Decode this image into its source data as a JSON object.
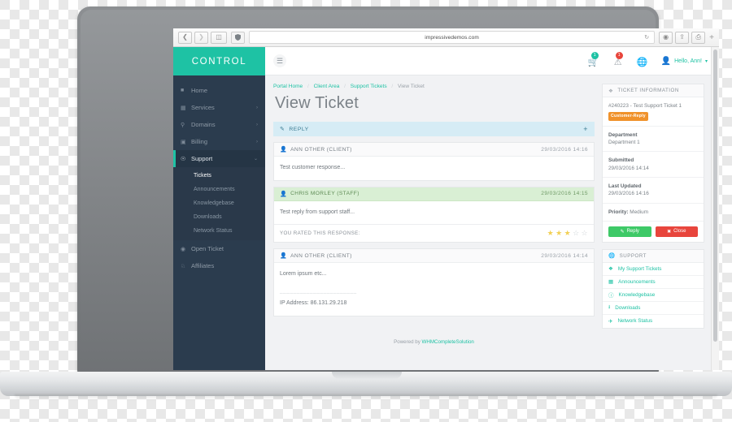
{
  "browser": {
    "url": "impressivedemos.com",
    "back_icon": "chevron-left-icon",
    "forward_icon": "chevron-right-icon",
    "sidebar_icon": "sidebar-toggle-icon",
    "shield_icon": "shield-icon",
    "reload_icon": "reload-icon",
    "download_icon": "download-icon",
    "share_icon": "share-icon",
    "tabs_icon": "tabs-icon",
    "newtab_label": "+"
  },
  "brand": {
    "name": "CONTROL"
  },
  "sidebar": {
    "items": [
      {
        "label": "Home",
        "icon": "home-icon",
        "caret": ""
      },
      {
        "label": "Services",
        "icon": "services-icon",
        "caret": "›"
      },
      {
        "label": "Domains",
        "icon": "domains-icon",
        "caret": "›"
      },
      {
        "label": "Billing",
        "icon": "billing-icon",
        "caret": "›"
      },
      {
        "label": "Support",
        "icon": "support-icon",
        "caret": "⌄"
      }
    ],
    "sub_items": [
      {
        "label": "Tickets"
      },
      {
        "label": "Announcements"
      },
      {
        "label": "Knowledgebase"
      },
      {
        "label": "Downloads"
      },
      {
        "label": "Network Status"
      }
    ],
    "items_after": [
      {
        "label": "Open Ticket",
        "icon": "chat-icon"
      },
      {
        "label": "Affiliates",
        "icon": "affiliates-icon"
      }
    ]
  },
  "topbar": {
    "menu_icon": "hamburger-icon",
    "cart_icon": "cart-icon",
    "cart_badge": "1",
    "alert_icon": "warning-triangle-icon",
    "alert_badge": "1",
    "globe_icon": "globe-icon",
    "user_icon": "user-icon",
    "user_label": "Hello, Ann!",
    "user_caret": "▾"
  },
  "breadcrumb": {
    "items": [
      "Portal Home",
      "Client Area",
      "Support Tickets"
    ],
    "current": "View Ticket",
    "separator": "/"
  },
  "page": {
    "title": "View Ticket"
  },
  "reply_bar": {
    "icon": "pencil-icon",
    "label": "REPLY",
    "expand": "+"
  },
  "messages": [
    {
      "author": "ANN OTHER (CLIENT)",
      "timestamp": "29/03/2016 14:16",
      "body": "Test customer response...",
      "role": "client",
      "icon": "user-icon"
    },
    {
      "author": "CHRIS MORLEY (STAFF)",
      "timestamp": "29/03/2016 14:15",
      "body": "Test reply from support staff...",
      "role": "staff",
      "icon": "user-icon",
      "rating": {
        "label": "YOU RATED THIS RESPONSE:",
        "filled": 3,
        "total": 5
      }
    },
    {
      "author": "ANN OTHER (CLIENT)",
      "timestamp": "29/03/2016 14:14",
      "body": "Lorem ipsum etc...",
      "divider": "_______________________",
      "extra": "IP Address: 86.131.29.218",
      "role": "client",
      "icon": "user-icon"
    }
  ],
  "footer": {
    "prefix": "Powered by ",
    "brand": "WHMCompleteSolution"
  },
  "ticket_info": {
    "heading": "TICKET INFORMATION",
    "heading_icon": "ticket-icon",
    "subject": "#240223 - Test Support Ticket 1",
    "status_badge": "Customer-Reply",
    "status_color": "#f0922b",
    "department_label": "Department",
    "department_value": "Department 1",
    "submitted_label": "Submitted",
    "submitted_value": "29/03/2016 14:14",
    "updated_label": "Last Updated",
    "updated_value": "29/03/2016 14:16",
    "priority_label": "Priority:",
    "priority_value": "Medium",
    "reply_button": "Reply",
    "reply_icon": "pencil-icon",
    "close_button": "Close",
    "close_icon": "close-icon"
  },
  "support_panel": {
    "heading": "SUPPORT",
    "heading_icon": "globe-icon",
    "links": [
      {
        "label": "My Support Tickets",
        "icon": "ticket-icon"
      },
      {
        "label": "Announcements",
        "icon": "announcement-icon"
      },
      {
        "label": "Knowledgebase",
        "icon": "info-icon"
      },
      {
        "label": "Downloads",
        "icon": "download-icon"
      },
      {
        "label": "Network Status",
        "icon": "signal-icon"
      }
    ]
  },
  "theme": {
    "accent": "#1ec2a4",
    "sidebar_bg": "#2b3c4e",
    "danger": "#e8453c",
    "success": "#3ec967"
  }
}
